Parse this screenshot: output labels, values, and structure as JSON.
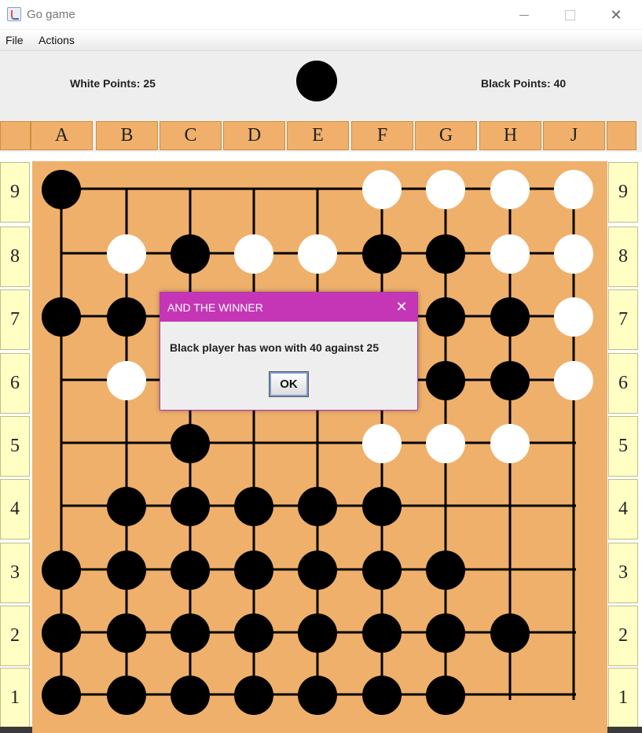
{
  "window": {
    "title": "Go game",
    "controls": {
      "minimize": "minimize",
      "maximize": "maximize",
      "close": "✕"
    }
  },
  "menu": {
    "file": "File",
    "actions": "Actions"
  },
  "header": {
    "white_points": "White Points: 25",
    "black_points": "Black Points: 40",
    "turn_stone_color": "black"
  },
  "board": {
    "columns": [
      "A",
      "B",
      "C",
      "D",
      "E",
      "F",
      "G",
      "H",
      "J"
    ],
    "rows": [
      "9",
      "8",
      "7",
      "6",
      "5",
      "4",
      "3",
      "2",
      "1"
    ],
    "stones": [
      [
        "B",
        ".",
        ".",
        ".",
        ".",
        "W",
        "W",
        "W",
        "W"
      ],
      [
        ".",
        "W",
        "B",
        "W",
        "W",
        "B",
        "B",
        "W",
        "W"
      ],
      [
        "B",
        "B",
        ".",
        ".",
        ".",
        ".",
        "B",
        "B",
        "W"
      ],
      [
        ".",
        "W",
        ".",
        ".",
        ".",
        ".",
        "B",
        "B",
        "W"
      ],
      [
        ".",
        ".",
        "B",
        ".",
        ".",
        "W",
        "W",
        "W",
        "."
      ],
      [
        ".",
        "B",
        "B",
        "B",
        "B",
        "B",
        ".",
        ".",
        "."
      ],
      [
        "B",
        "B",
        "B",
        "B",
        "B",
        "B",
        "B",
        ".",
        "."
      ],
      [
        "B",
        "B",
        "B",
        "B",
        "B",
        "B",
        "B",
        "B",
        "."
      ],
      [
        "B",
        "B",
        "B",
        "B",
        "B",
        "B",
        "B",
        ".",
        "."
      ]
    ],
    "colors": {
      "board": "#efb06c",
      "black": "#000000",
      "white": "#ffffff",
      "line": "#000000"
    }
  },
  "dialog": {
    "title": "AND THE WINNER",
    "message": "Black player has won with 40 against 25",
    "ok_label": "OK",
    "close_glyph": "✕",
    "accent": "#c436b6"
  }
}
